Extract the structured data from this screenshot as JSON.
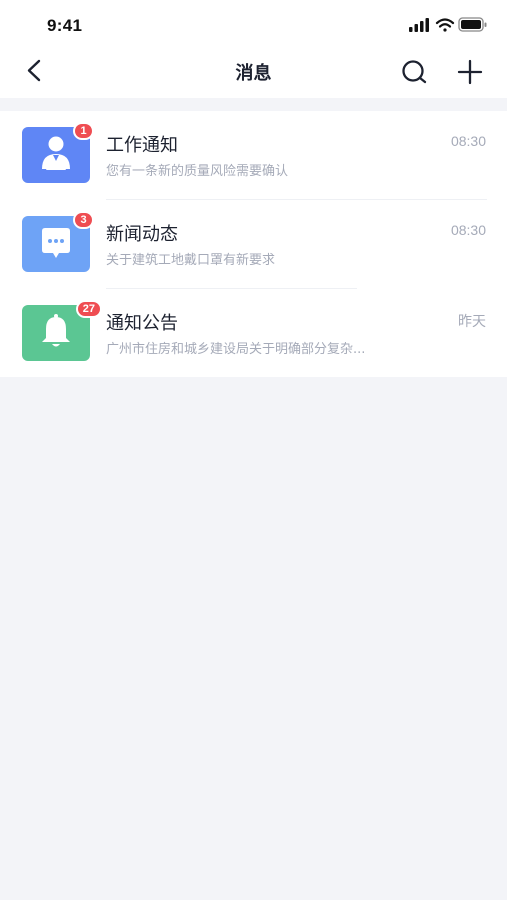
{
  "status_bar": {
    "time": "9:41",
    "icons": [
      "cellular-signal-icon",
      "wifi-icon",
      "battery-icon"
    ]
  },
  "nav": {
    "title": "消息",
    "back_icon": "chevron-left-icon",
    "search_icon": "search-icon",
    "add_icon": "plus-icon"
  },
  "messages": [
    {
      "title": "工作通知",
      "subtitle": "您有一条新的质量风险需要确认",
      "time": "08:30",
      "badge": "1",
      "icon": "worker-icon",
      "color": "#5f86f5"
    },
    {
      "title": "新闻动态",
      "subtitle": "关于建筑工地戴口罩有新要求",
      "time": "08:30",
      "badge": "3",
      "icon": "chat-bubble-icon",
      "color": "#6ea3f6"
    },
    {
      "title": "通知公告",
      "subtitle": "广州市住房和城乡建设局关于明确部分复杂...",
      "time": "昨天",
      "badge": "27",
      "icon": "bell-icon",
      "color": "#5bc693"
    }
  ],
  "colors": {
    "background": "#f3f4f8",
    "badge": "#ef4d52",
    "secondary_text": "#a5aab8"
  }
}
